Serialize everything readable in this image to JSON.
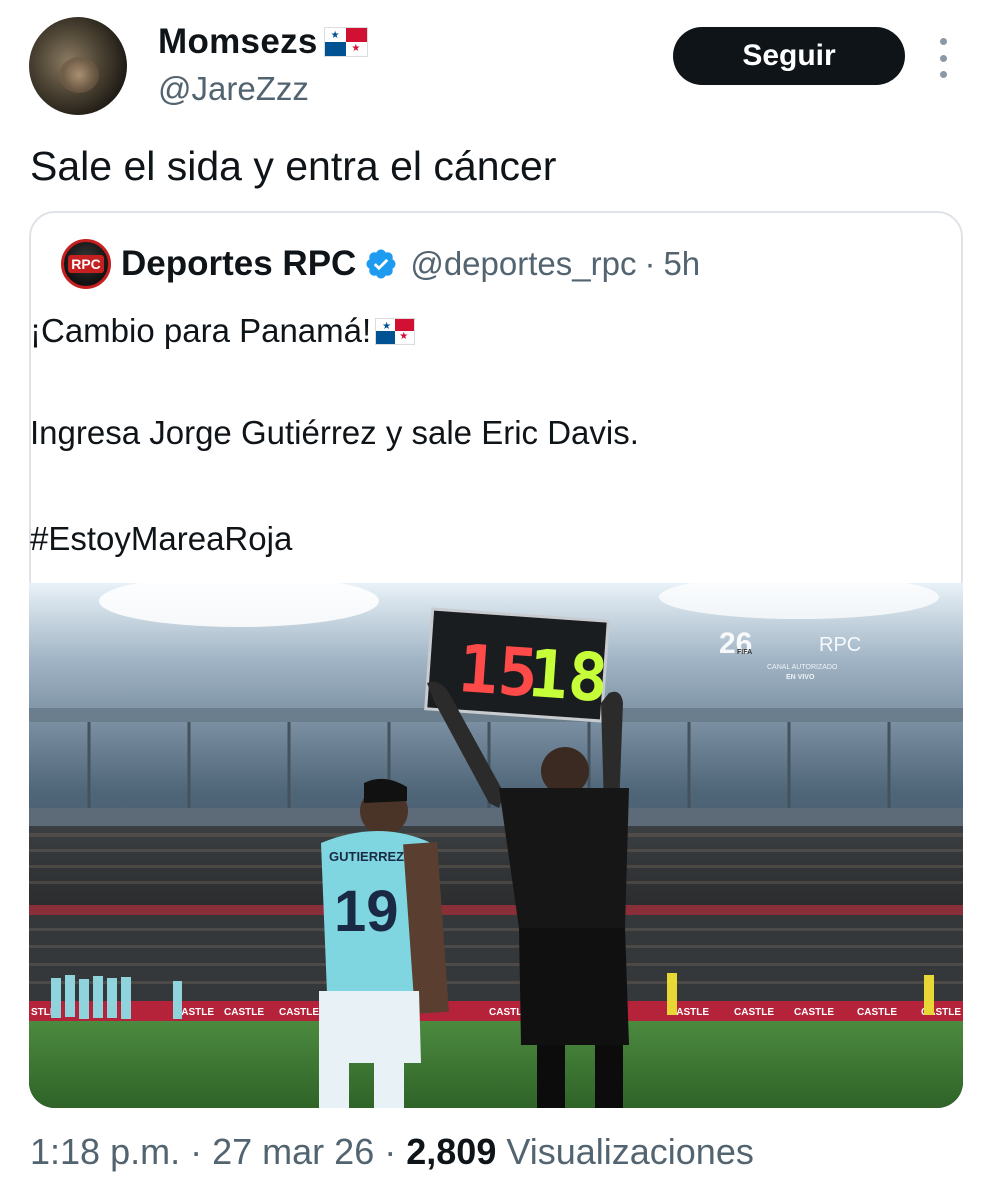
{
  "author": {
    "display_name": "Momsezs",
    "handle": "@JareZzz"
  },
  "follow_button": {
    "label": "Seguir"
  },
  "tweet": {
    "text": "Sale el sida y entra el cáncer"
  },
  "quoted_tweet": {
    "author_name": "Deportes RPC",
    "author_handle": "@deportes_rpc",
    "separator": "·",
    "time_ago": "5h",
    "logo_text": "RPC",
    "line1": "¡Cambio para Panamá!",
    "line2": "Ingresa Jorge Gutiérrez y sale Eric Davis.",
    "line3": "#EstoyMareaRoja",
    "media": {
      "board_out_number": "15",
      "board_in_number": "18",
      "player_name": "GUTIERREZ",
      "player_number": "19",
      "broadcast_logo": "26",
      "broadcast_fifa": "FIFA",
      "broadcast_channel": "RPC",
      "broadcast_sub1": "CANAL AUTORIZADO",
      "broadcast_sub2": "EN VIVO",
      "ad_board_text": "CASTLE",
      "ad_board_left": "STLE",
      "colors": {
        "board_red": "#ff4a4a",
        "board_green": "#c6ff3a",
        "jersey": "#7fd6e0",
        "pitch": "#3e7a37"
      }
    }
  },
  "meta": {
    "time": "1:18 p.m.",
    "sep1": "·",
    "date": "27 mar 26",
    "sep2": "·",
    "views_count": "2,809",
    "views_label": "Visualizaciones"
  },
  "colors": {
    "text_primary": "#0f1419",
    "text_secondary": "#536471",
    "verified": "#1d9bf0",
    "border": "#dfe3e7"
  }
}
